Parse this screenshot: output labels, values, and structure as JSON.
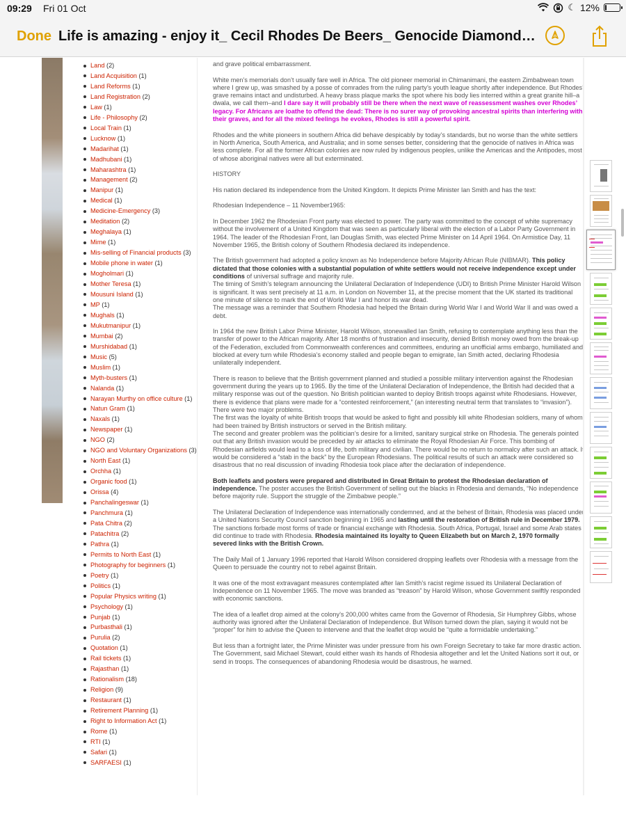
{
  "status": {
    "time": "09:29",
    "date": "Fri 01 Oct",
    "battery": "12%",
    "battery_level": 0.12
  },
  "nav": {
    "done": "Done",
    "title": "Life is amazing - enjoy it_ Cecil Rhodes De Beers_ Genocide Diamonds..."
  },
  "categories": [
    {
      "label": "Land",
      "count": "(2)"
    },
    {
      "label": "Land Acquisition",
      "count": "(1)"
    },
    {
      "label": "Land Reforms",
      "count": "(1)"
    },
    {
      "label": "Land Registration",
      "count": "(2)"
    },
    {
      "label": "Law",
      "count": "(1)"
    },
    {
      "label": "Life - Philosophy",
      "count": "(2)"
    },
    {
      "label": "Local Train",
      "count": "(1)"
    },
    {
      "label": "Lucknow",
      "count": "(1)"
    },
    {
      "label": "Madarihat",
      "count": "(1)"
    },
    {
      "label": "Madhubani",
      "count": "(1)"
    },
    {
      "label": "Maharashtra",
      "count": "(1)"
    },
    {
      "label": "Management",
      "count": "(2)"
    },
    {
      "label": "Manipur",
      "count": "(1)"
    },
    {
      "label": "Medical",
      "count": "(1)"
    },
    {
      "label": "Medicine-Emergency",
      "count": "(3)"
    },
    {
      "label": "Meditation",
      "count": "(2)"
    },
    {
      "label": "Meghalaya",
      "count": "(1)"
    },
    {
      "label": "Mime",
      "count": "(1)"
    },
    {
      "label": "Mis-selling of Financial products",
      "count": "(3)"
    },
    {
      "label": "Mobile phone in water",
      "count": "(1)"
    },
    {
      "label": "Mogholmari",
      "count": "(1)"
    },
    {
      "label": "Mother Teresa",
      "count": "(1)"
    },
    {
      "label": "Mousuni Island",
      "count": "(1)"
    },
    {
      "label": "MP",
      "count": "(1)"
    },
    {
      "label": "Mughals",
      "count": "(1)"
    },
    {
      "label": "Mukutmanipur",
      "count": "(1)"
    },
    {
      "label": "Mumbai",
      "count": "(2)"
    },
    {
      "label": "Murshidabad",
      "count": "(1)"
    },
    {
      "label": "Music",
      "count": "(5)"
    },
    {
      "label": "Muslim",
      "count": "(1)"
    },
    {
      "label": "Myth-busters",
      "count": "(1)"
    },
    {
      "label": "Nalanda",
      "count": "(1)"
    },
    {
      "label": "Narayan Murthy on office culture",
      "count": "(1)"
    },
    {
      "label": "Natun Gram",
      "count": "(1)"
    },
    {
      "label": "Naxals",
      "count": "(1)"
    },
    {
      "label": "Newspaper",
      "count": "(1)"
    },
    {
      "label": "NGO",
      "count": "(2)"
    },
    {
      "label": "NGO and Voluntary Organizations",
      "count": "(3)"
    },
    {
      "label": "North East",
      "count": "(1)"
    },
    {
      "label": "Orchha",
      "count": "(1)"
    },
    {
      "label": "Organic food",
      "count": "(1)"
    },
    {
      "label": "Orissa",
      "count": "(4)"
    },
    {
      "label": "Panchalingeswar",
      "count": "(1)"
    },
    {
      "label": "Panchmura",
      "count": "(1)"
    },
    {
      "label": "Pata Chitra",
      "count": "(2)"
    },
    {
      "label": "Patachitra",
      "count": "(2)"
    },
    {
      "label": "Pathra",
      "count": "(1)"
    },
    {
      "label": "Permits to North East",
      "count": "(1)"
    },
    {
      "label": "Photography for beginners",
      "count": "(1)"
    },
    {
      "label": "Poetry",
      "count": "(1)"
    },
    {
      "label": "Politics",
      "count": "(1)"
    },
    {
      "label": "Popular Physics writing",
      "count": "(1)"
    },
    {
      "label": "Psychology",
      "count": "(1)"
    },
    {
      "label": "Punjab",
      "count": "(1)"
    },
    {
      "label": "Purbasthali",
      "count": "(1)"
    },
    {
      "label": "Purulia",
      "count": "(2)"
    },
    {
      "label": "Quotation",
      "count": "(1)"
    },
    {
      "label": "Rail tickets",
      "count": "(1)"
    },
    {
      "label": "Rajasthan",
      "count": "(1)"
    },
    {
      "label": "Rationalism",
      "count": "(18)"
    },
    {
      "label": "Religion",
      "count": "(9)"
    },
    {
      "label": "Restaurant",
      "count": "(1)"
    },
    {
      "label": "Retirement Planning",
      "count": "(1)"
    },
    {
      "label": "Right to Information Act",
      "count": "(1)"
    },
    {
      "label": "Rome",
      "count": "(1)"
    },
    {
      "label": "RTI",
      "count": "(1)"
    },
    {
      "label": "Safari",
      "count": "(1)"
    },
    {
      "label": "SARFAESI",
      "count": "(1)"
    }
  ],
  "article": {
    "p0": "and grave political embarrassment.",
    "p1a": "White men’s memorials don’t usually fare well in Africa. The old pioneer memorial in Chimanimani, the eastern Zimbabwean town where I grew up, was smashed by a posse of comrades from the ruling party’s youth league shortly after independence. But Rhodes’ grave remains intact and undisturbed. A heavy brass plaque marks the spot where his body lies interred within a great granite hill–a dwala, we call them–and ",
    "p1b": "I dare say it will probably still be there when the next wave of reassessment washes over Rhodes’ legacy. For Africans are loathe to offend the dead: There is no surer way of provoking ancestral spirits than interfering with their graves, and for all the mixed feelings he evokes, Rhodes is still a powerful spirit.",
    "p2": "Rhodes and the white pioneers in southern Africa did behave despicably by today’s standards, but no worse than the white settlers in North America, South America, and Australia; and in some senses better, considering that the genocide of natives in Africa was less complete. For all the former African colonies are now ruled by indigenous peoples, unlike the Americas and the Antipodes, most of whose aboriginal natives were all but exterminated.",
    "p3": "HISTORY",
    "p4": "His nation declared its independence from the United Kingdom. It depicts Prime Minister Ian Smith and has the text:",
    "p5": "Rhodesian Independence – 11 November1965:",
    "p6": "In December 1962 the Rhodesian Front party was elected to power. The party was committed to the concept of white supremacy without the involvement of a United Kingdom that was seen as particularly liberal with the election of a Labor Party Government in 1964. The leader of the Rhodesian Front, Ian Douglas Smith, was elected Prime Minister on 14 April 1964. On Armistice Day, 11 November 1965, the British colony of Southern Rhodesia declared its independence.",
    "p7a": "The British government had adopted a policy known as No Independence before Majority African Rule (NIBMAR). ",
    "p7b": "This policy dictated that those colonies with a substantial population of white settlers would not receive independence except under conditions",
    "p7c": " of universal suffrage and majority rule.",
    "p7d": "The timing of Smith’s telegram announcing the Unilateral Declaration of Independence (UDI) to British Prime Minister Harold Wilson is significant. It was sent precisely at 11 a.m. in London on November 11, at the precise moment that the UK started its traditional one minute of silence to mark the end of World War I and honor its war dead.",
    "p7e": "The message was a reminder that Southern Rhodesia had helped the Britain during World War I and World War II and was owed a debt.",
    "p8": "In 1964 the new British Labor Prime Minister, Harold Wilson, stonewalled Ian Smith, refusing to contemplate anything less than the transfer of power to the African majority. After 18 months of frustration and insecurity, denied British money owed from the break-up of the Federation, excluded from Commonwealth conferences and committees, enduring an unofficial arms embargo, humiliated and blocked at every turn while Rhodesia’s economy stalled and people began to emigrate, Ian Smith acted, declaring Rhodesia unilaterally independent.",
    "p9a": "There is reason to believe that the British government planned and studied a possible military intervention against the Rhodesian government during the years up to 1965. By the time of the Unilateral Declaration of Independence, the British had decided that a military response was out of the question. No British politician wanted to deploy British troops against white Rhodesians. However, there is evidence that plans were made for a “contested reinforcement,” (an interesting neutral term that translates to “invasion”). There were two major problems.",
    "p9b": "The first was the loyalty of white British troops that would be asked to fight and possibly kill white Rhodesian soldiers, many of whom had been trained by British instructors or served in the British military.",
    "p9c": "The second and greater problem was the politician’s desire for a limited, sanitary surgical strike on Rhodesia. The generals pointed out that any British invasion would be preceded by air attacks to eliminate the Royal Rhodesian Air Force. This bombing of Rhodesian airfields would lead to a loss of life, both military and civilian. There would be no return to normalcy after such an attack. It would be considered a “stab in the back” by the European Rhodesians. The political results of such an attack were considered so disastrous that no real discussion of invading Rhodesia took place after the declaration of independence.",
    "p10a": "Both leaflets and posters were prepared and distributed in Great Britain to protest the Rhodesian declaration of independence.",
    "p10b": " The poster accuses the British Government of selling out the blacks in Rhodesia and demands, “No independence before majority rule. Support the struggle of the Zimbabwe people.”",
    "p11a": "The Unilateral Declaration of Independence was internationally condemned, and at the behest of Britain, Rhodesia was placed under a United Nations Security Council sanction beginning in 1965 and ",
    "p11b": "lasting until the restoration of British rule in December 1979.",
    "p11c": " The sanctions forbade most forms of trade or financial exchange with Rhodesia. South Africa, Portugal, Israel and some Arab states did continue to trade with Rhodesia. ",
    "p11d": "Rhodesia maintained its loyalty to Queen Elizabeth but on March 2, 1970 formally severed links with the British Crown.",
    "p12": "The Daily Mail of 1 January 1996 reported that Harold Wilson considered dropping leaflets over Rhodesia with a message from the Queen to persuade the country not to rebel against Britain.",
    "p13": "It was one of the most extravagant measures contemplated after Ian Smith’s racist regime issued its Unilateral Declaration of Independence on 11 November 1965. The move was branded as “treason” by Harold Wilson, whose Government swiftly responded with economic sanctions.",
    "p14": "The idea of a leaflet drop aimed at the colony’s 200,000 whites came from the Governor of Rhodesia, Sir Humphrey Gibbs, whose authority was ignored after the Unilateral Declaration of Independence. But Wilson turned down the plan, saying it would not be “proper” for him to advise the Queen to intervene and that the leaflet drop would be “quite a formidable undertaking.”",
    "p15": "But less than a fortnight later, the Prime Minister was under pressure from his own Foreign Secretary to take far more drastic action. The Government, said Michael Stewart, could either wash its hands of Rhodesia altogether and let the United Nations sort it out, or send in troops. The consequences of abandoning Rhodesia would be disastrous, he warned."
  },
  "colors": {
    "accent": "#e0a100",
    "link": "#cc2200",
    "highlight": "#d400d4"
  },
  "icons": {
    "wifi": "wifi-icon",
    "rotation_lock": "rotation-lock-icon",
    "moon": "moon-icon",
    "battery": "battery-icon",
    "markup": "markup-pen-icon",
    "share": "share-icon"
  }
}
